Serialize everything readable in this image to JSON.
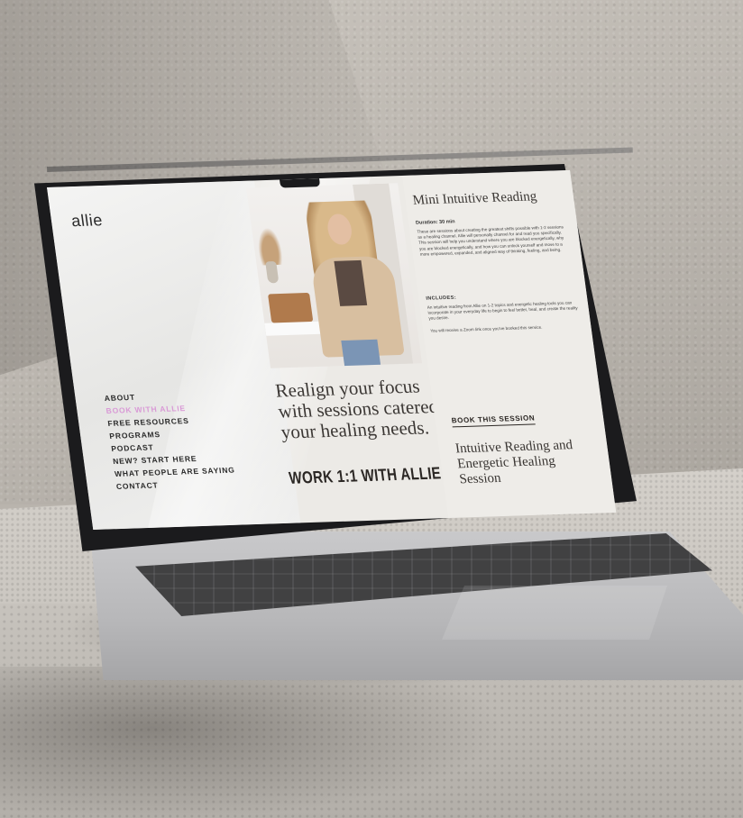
{
  "site": {
    "logo": "allie",
    "nav": [
      {
        "label": "ABOUT",
        "active": false
      },
      {
        "label": "BOOK WITH ALLIE",
        "active": true
      },
      {
        "label": "FREE RESOURCES",
        "active": false
      },
      {
        "label": "PROGRAMS",
        "active": false
      },
      {
        "label": "PODCAST",
        "active": false
      },
      {
        "label": "NEW? START HERE",
        "active": false
      },
      {
        "label": "WHAT PEOPLE ARE SAYING",
        "active": false
      },
      {
        "label": "CONTACT",
        "active": false
      }
    ],
    "accent_color": "#d99ad6"
  },
  "hero": {
    "headline": "Realign your focus with sessions catered to your healing needs.",
    "subhead": "WORK 1:1 WITH ALLIE"
  },
  "session": {
    "title": "Mini Intuitive Reading",
    "duration": "Duration: 30 min",
    "description": "These are sessions about creating the greatest shifts possible with 1-2 sessions as a healing channel. Allie will personally channel for and read you specifically. This session will help you understand where you are blocked energetically, why you are blocked energetically, and how you can unlock yourself and move to a more empowered, expanded, and aligned way of thinking, feeling, and being.",
    "includes_label": "INCLUDES:",
    "includes_text": "An intuitive reading from Allie on 1-2 topics and energetic healing tools you can incorporate in your everyday life to begin to feel better, heal, and create the reality you desire.",
    "zoom_note": "You will receive a Zoom link once you've booked this service.",
    "book_label": "BOOK THIS SESSION",
    "next_title": "Intuitive Reading and Energetic Healing Session"
  }
}
